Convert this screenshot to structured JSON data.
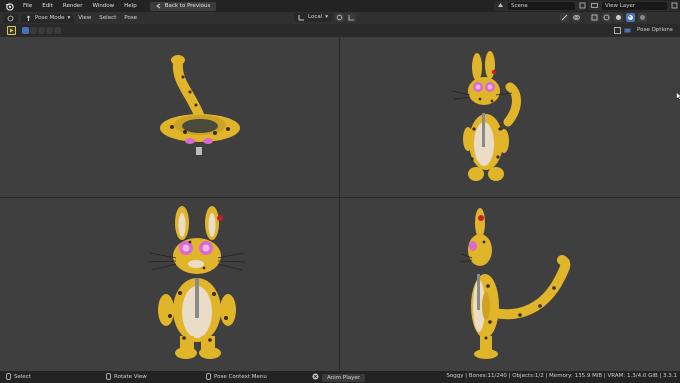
{
  "menubar": {
    "items": [
      "File",
      "Edit",
      "Render",
      "Window",
      "Help"
    ],
    "back_label": "Back to Previous",
    "scene": "Scene",
    "view_layer": "View Layer"
  },
  "viewport_header": {
    "mode": "Pose Mode",
    "menus": [
      "View",
      "Select",
      "Pose"
    ],
    "transform_orientation": "Local"
  },
  "toolbar": {
    "pose_options": "Pose Options"
  },
  "statusbar": {
    "select": "Select",
    "rotate": "Rotate View",
    "context_menu": "Pose Context Menu",
    "anim_player": "Anim Player",
    "stats": "Soggy | Bones:11/240 | Objects:1/2 | Memory: 135.9 MiB | VRAM: 1.3/4.0 GiB | 3.3.1"
  },
  "colors": {
    "viewport_bg": "#3f3f3f",
    "fur_yellow": "#e1b52a",
    "spots": "#3a2a10",
    "belly": "#eadcc6",
    "glasses": "#d86ad0",
    "accent": "#4772b3"
  }
}
